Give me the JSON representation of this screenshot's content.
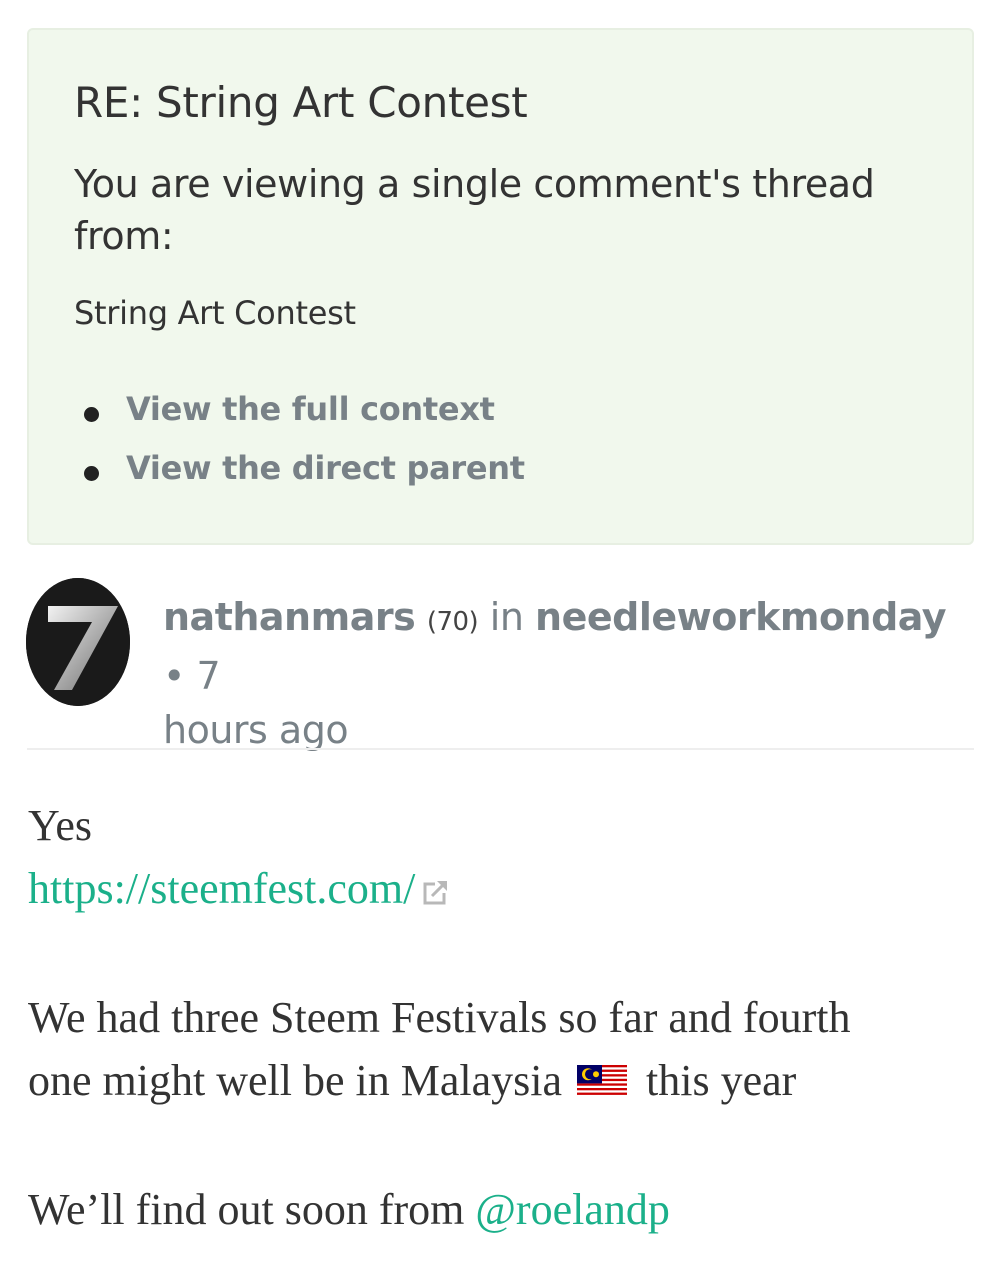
{
  "thread_notice": {
    "title": "RE: String Art Contest",
    "subtitle": "You are viewing a single comment's thread from:",
    "post_title": "String Art Contest",
    "links": [
      {
        "label": "View the full context"
      },
      {
        "label": "View the direct parent"
      }
    ]
  },
  "comment": {
    "author": "nathanmars",
    "reputation": "(70)",
    "in_label": "in",
    "community": "needleworkmonday",
    "separator": "•",
    "timestamp_part1": "7",
    "timestamp_part2": "hours ago",
    "body": {
      "line1": "Yes",
      "link": "https://steemfest.com/",
      "para2_line1": "We had three Steem Festivals so far and fourth",
      "para2_line2_start": "one might well be in Malaysia",
      "para2_line2_end": "this year",
      "para3_start": "We’ll find out soon from",
      "mention": "@roelandp"
    }
  },
  "colors": {
    "callout_bg": "#f1f8ed",
    "link_teal": "#1bb08a",
    "muted_gray": "#788187"
  },
  "icons": [
    "external-link-icon",
    "malaysia-flag-icon",
    "avatar-seven-logo"
  ]
}
